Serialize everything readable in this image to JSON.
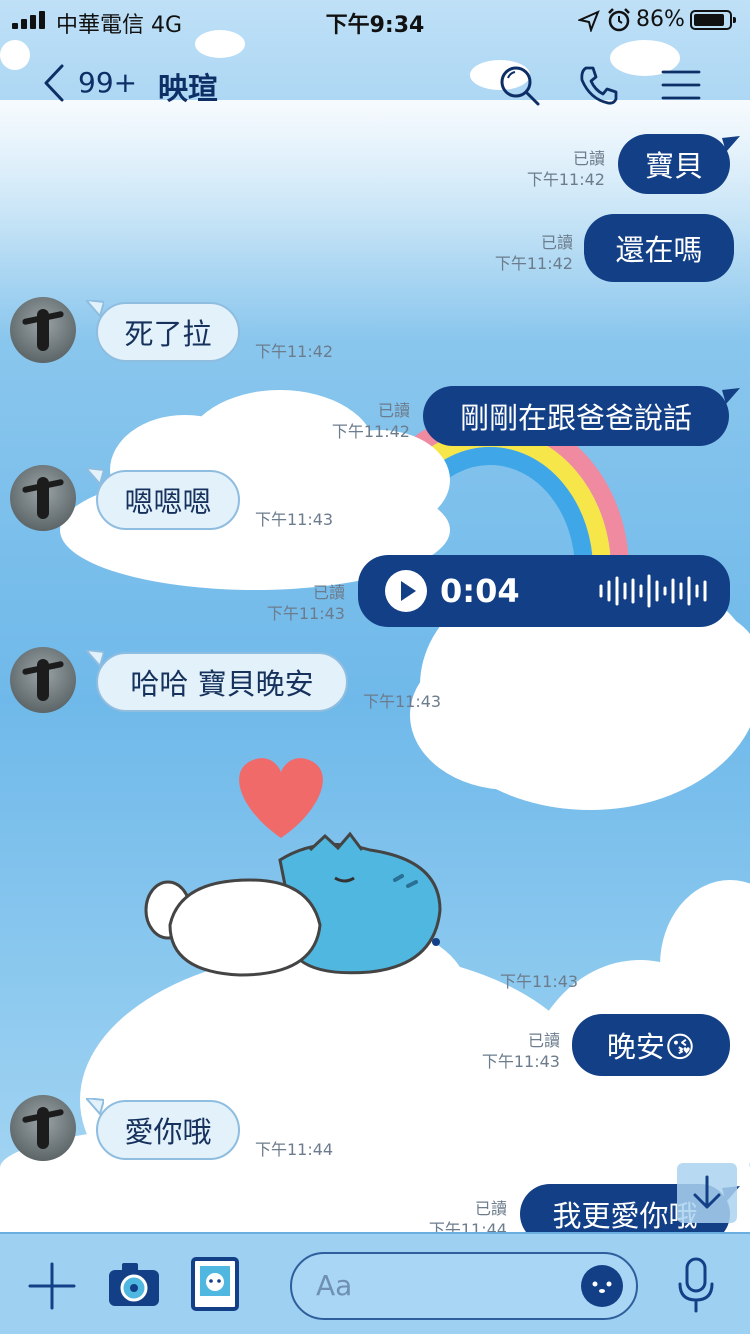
{
  "status_bar": {
    "carrier": "中華電信  4G",
    "time": "下午9:34",
    "battery_percent": "86%"
  },
  "header": {
    "unread_count": "99+",
    "contact_name": "映瑄"
  },
  "messages": [
    {
      "dir": "out",
      "text": "寶貝",
      "read": "已讀",
      "time": "下午11:42"
    },
    {
      "dir": "out",
      "text": "還在嗎",
      "read": "已讀",
      "time": "下午11:42"
    },
    {
      "dir": "in",
      "text": "死了拉",
      "time": "下午11:42"
    },
    {
      "dir": "out",
      "text": "剛剛在跟爸爸說話",
      "read": "已讀",
      "time": "下午11:42"
    },
    {
      "dir": "in",
      "text": "嗯嗯嗯",
      "time": "下午11:43"
    },
    {
      "dir": "out",
      "type": "voice",
      "duration": "0:04",
      "read": "已讀",
      "time": "下午11:43"
    },
    {
      "dir": "in",
      "text": "哈哈 寶貝晚安",
      "time": "下午11:43"
    },
    {
      "dir": "in",
      "type": "sticker",
      "time": "下午11:43"
    },
    {
      "dir": "out",
      "text": "晚安😘",
      "read": "已讀",
      "time": "下午11:43"
    },
    {
      "dir": "in",
      "text": "愛你哦",
      "time": "下午11:44"
    },
    {
      "dir": "out",
      "text": "我更愛你哦",
      "read": "已讀",
      "time": "下午11:44"
    }
  ],
  "input": {
    "placeholder": "Aa"
  },
  "colors": {
    "outgoing_bubble": "#123f86",
    "incoming_bubble": "#e3f1fb",
    "header_text": "#0d2f66",
    "heart": "#f06a6a",
    "sticker_blue": "#4fb7e0"
  },
  "icons": [
    "back-chevron-icon",
    "search-icon",
    "phone-icon",
    "menu-icon",
    "play-icon",
    "waveform-icon",
    "plus-icon",
    "camera-icon",
    "photo-icon",
    "emoji-icon",
    "microphone-icon",
    "scroll-down-icon"
  ]
}
